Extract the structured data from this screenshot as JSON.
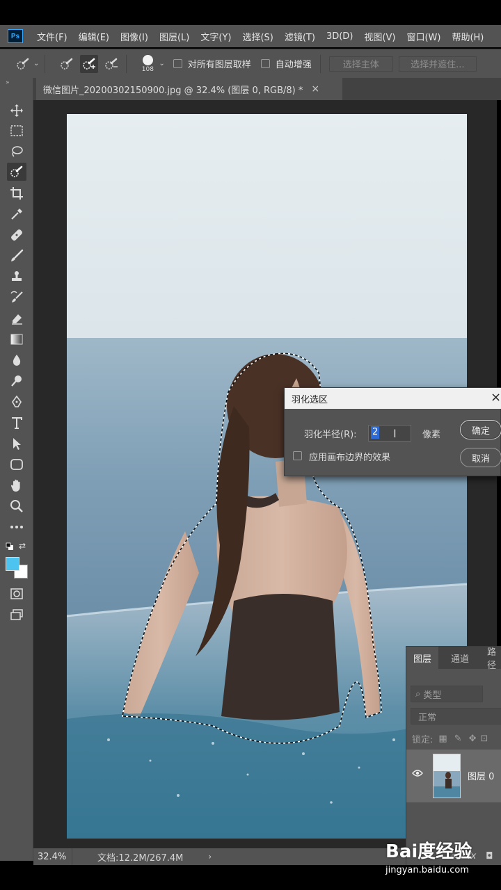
{
  "app": {
    "logo": "Ps",
    "menu": [
      "文件(F)",
      "编辑(E)",
      "图像(I)",
      "图层(L)",
      "文字(Y)",
      "选择(S)",
      "滤镜(T)",
      "3D(D)",
      "视图(V)",
      "窗口(W)",
      "帮助(H)"
    ]
  },
  "options": {
    "brush_size": "108",
    "sample_all_layers": "对所有图层取样",
    "auto_enhance": "自动增强",
    "select_subject": "选择主体",
    "select_and_mask": "选择并遮住..."
  },
  "document": {
    "tab_title": "微信图片_20200302150900.jpg @ 32.4% (图层 0, RGB/8) *",
    "zoom": "32.4%",
    "doc_size": "文档:12.2M/267.4M"
  },
  "dialog": {
    "title": "羽化选区",
    "radius_label": "羽化半径(R):",
    "radius_value": "2",
    "unit": "像素",
    "canvas_edge_label": "应用画布边界的效果",
    "ok": "确定",
    "cancel": "取消"
  },
  "layers_panel": {
    "tabs": [
      "图层",
      "通道",
      "路径"
    ],
    "filter_placeholder": "类型",
    "blend_mode": "正常",
    "lock_label": "锁定:",
    "layer_name": "图层 0",
    "footer_icons": [
      "link-icon",
      "fx-icon",
      "mask-icon"
    ]
  },
  "colors": {
    "foreground": "#4dc3f0",
    "background": "#ffffff",
    "selection_accent": "#2e6bd6"
  },
  "watermark": {
    "brand": "Bai度经验",
    "url": "jingyan.baidu.com"
  }
}
